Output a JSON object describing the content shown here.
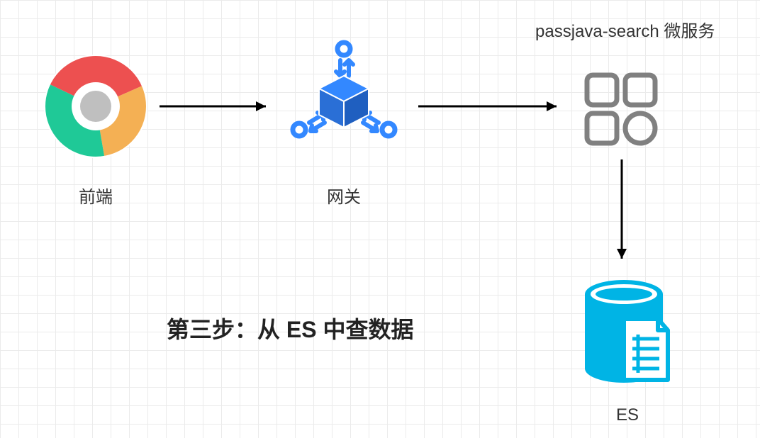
{
  "nodes": {
    "frontend": {
      "label": "前端"
    },
    "gateway": {
      "label": "网关"
    },
    "service": {
      "label": "passjava-search 微服务"
    },
    "es": {
      "label": "ES"
    }
  },
  "caption": "第三步：从 ES 中查数据",
  "colors": {
    "chrome_red": "#ED5050",
    "chrome_green": "#1FC997",
    "chrome_yellow": "#F4B054",
    "chrome_grey": "#BFBFBF",
    "gateway_blue": "#3388FF",
    "service_grey": "#808080",
    "es_cyan": "#00B4E5",
    "arrow": "#000000"
  }
}
